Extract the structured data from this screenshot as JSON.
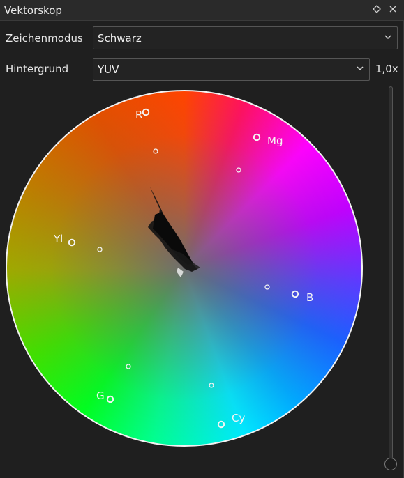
{
  "window": {
    "title": "Vektorskop",
    "float_icon": "diamond-icon",
    "close_icon": "close-icon"
  },
  "controls": {
    "draw_mode": {
      "label": "Zeichenmodus",
      "value": "Schwarz"
    },
    "background": {
      "label": "Hintergrund",
      "value": "YUV"
    },
    "zoom_label": "1,0x"
  },
  "scope": {
    "targets": [
      {
        "name": "R",
        "label": "R"
      },
      {
        "name": "Mg",
        "label": "Mg"
      },
      {
        "name": "Yl",
        "label": "Yl"
      },
      {
        "name": "B",
        "label": "B"
      },
      {
        "name": "G",
        "label": "G"
      },
      {
        "name": "Cy",
        "label": "Cy"
      }
    ],
    "colors": {
      "red": "#ff2a10",
      "magenta": "#ff00ff",
      "blue": "#1a4bff",
      "cyan": "#00c8ff",
      "green": "#00ff20",
      "yellow": "#b8a000"
    }
  },
  "zoom_slider": {
    "level": 0.0
  }
}
